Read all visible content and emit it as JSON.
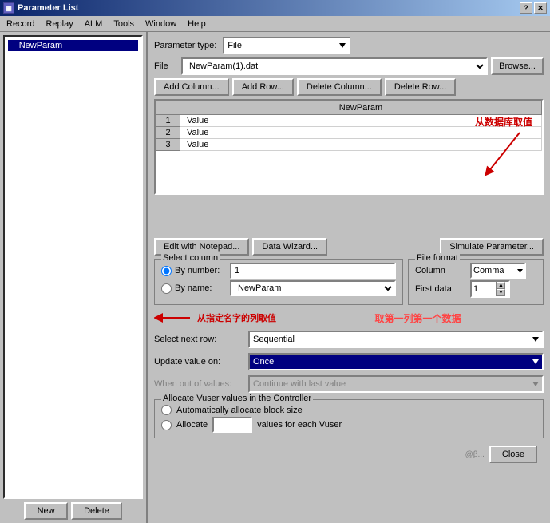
{
  "window": {
    "title": "Parameter List",
    "help_btn": "?",
    "close_btn": "✕"
  },
  "menu": {
    "items": [
      "Record",
      "Replay",
      "ALM",
      "Tools",
      "Window",
      "Help"
    ]
  },
  "left_panel": {
    "tree_item": "NewParam",
    "new_btn": "New",
    "delete_btn": "Delete"
  },
  "right_panel": {
    "param_type_label": "Parameter type:",
    "param_type_value": "File",
    "file_label": "File",
    "file_value": "NewParam(1).dat",
    "browse_btn": "Browse...",
    "add_column_btn": "Add Column...",
    "add_row_btn": "Add Row...",
    "delete_column_btn": "Delete Column...",
    "delete_row_btn": "Delete Row...",
    "table": {
      "col_header": "NewParam",
      "rows": [
        {
          "num": "1",
          "val": "Value"
        },
        {
          "num": "2",
          "val": "Value"
        },
        {
          "num": "3",
          "val": "Value"
        }
      ]
    },
    "annotation1": "从数据库取值",
    "edit_notepad_btn": "Edit with Notepad...",
    "data_wizard_btn": "Data Wizard...",
    "simulate_btn": "Simulate Parameter...",
    "select_column": {
      "legend": "Select column",
      "by_number_label": "By number:",
      "by_number_value": "1",
      "by_name_label": "By name:",
      "by_name_value": "NewParam"
    },
    "file_format": {
      "legend": "File format",
      "column_label": "Column",
      "column_value": "Comma",
      "first_data_label": "First data",
      "first_data_value": "1"
    },
    "annotation2": "从指定名字的列取值",
    "annotation3": "取第一列第一个数据",
    "select_next_row_label": "Select next row:",
    "select_next_row_value": "Sequential",
    "update_value_label": "Update value on:",
    "update_value_value": "Once",
    "when_out_label": "When out of values:",
    "when_out_value": "Continue with last value",
    "allocate_group": {
      "legend": "Allocate Vuser values in the Controller",
      "auto_radio": "Automatically allocate block size",
      "alloc_radio": "Allocate",
      "alloc_placeholder": "",
      "alloc_suffix": "values for each Vuser"
    },
    "close_btn": "Close",
    "watermark": "@β..."
  }
}
